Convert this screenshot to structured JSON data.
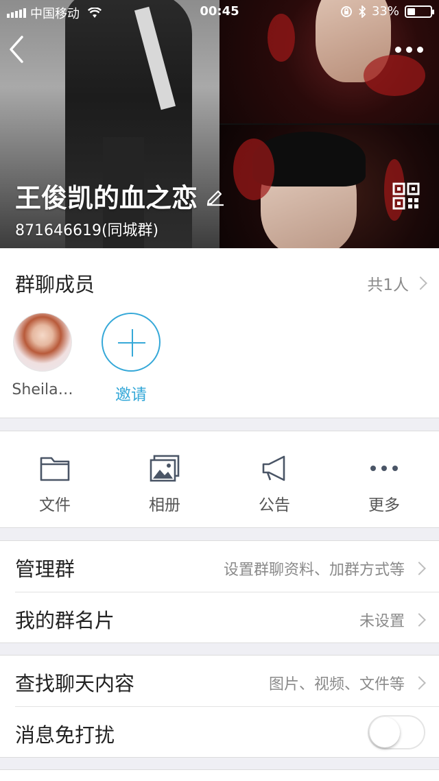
{
  "status_bar": {
    "carrier": "中国移动",
    "time": "00:45",
    "battery_percent": "33%",
    "battery_level": 0.33
  },
  "header": {
    "group_name": "王俊凯的血之恋",
    "group_id": "871646619(同城群)",
    "icons": [
      "back-icon",
      "more-icon",
      "edit-icon",
      "qr-code-icon"
    ]
  },
  "members": {
    "title": "群聊成员",
    "count": "共1人",
    "items": [
      {
        "name": "Sheila…"
      }
    ],
    "invite_label": "邀请"
  },
  "tools": [
    {
      "label": "文件",
      "icon": "folder-icon"
    },
    {
      "label": "相册",
      "icon": "album-icon"
    },
    {
      "label": "公告",
      "icon": "megaphone-icon"
    },
    {
      "label": "更多",
      "icon": "more-dots-icon"
    }
  ],
  "settings": {
    "manage": {
      "label": "管理群",
      "value": "设置群聊资料、加群方式等"
    },
    "card": {
      "label": "我的群名片",
      "value": "未设置"
    },
    "search": {
      "label": "查找聊天内容",
      "value": "图片、视频、文件等"
    },
    "dnd": {
      "label": "消息免打扰",
      "enabled": false
    }
  },
  "colors": {
    "accent": "#35a8d8",
    "background": "#efeff4",
    "secondary_text": "#8a8a8a"
  }
}
